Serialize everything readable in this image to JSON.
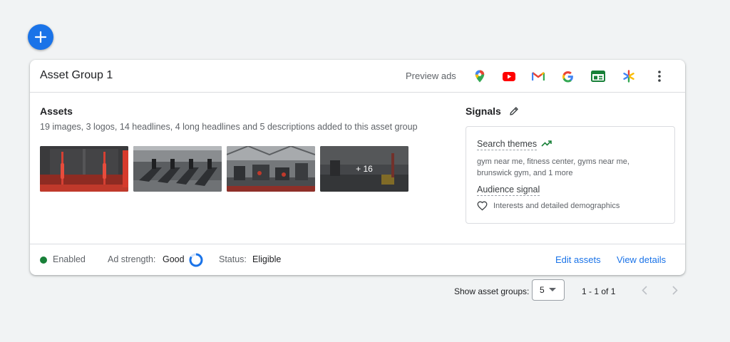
{
  "asset_group": {
    "title": "Asset Group 1",
    "preview_label": "Preview ads",
    "preview_icons": [
      "google-maps-icon",
      "youtube-icon",
      "gmail-icon",
      "google-search-icon",
      "display-network-icon",
      "discover-icon"
    ],
    "more_menu_icon": "more-vert-icon"
  },
  "assets": {
    "title": "Assets",
    "summary": "19 images, 3 logos, 14 headlines, 4 long headlines and 5 descriptions added to this asset group",
    "more_images_label": "+ 16"
  },
  "signals": {
    "title": "Signals",
    "search_themes_label": "Search themes",
    "search_themes_text": "gym near me, fitness center, gyms near me, brunswick gym, and 1 more",
    "audience_signal_label": "Audience signal",
    "audience_signal_text": "Interests and detailed demographics"
  },
  "footer": {
    "status_dot_color": "#188038",
    "enabled_label": "Enabled",
    "ad_strength_label": "Ad strength:",
    "ad_strength_value": "Good",
    "status_label": "Status:",
    "status_value": "Eligible",
    "edit_assets_label": "Edit assets",
    "view_details_label": "View details"
  },
  "pagination": {
    "show_label": "Show asset groups:",
    "page_size": "5",
    "range_text": "1 - 1 of 1"
  },
  "colors": {
    "accent": "#1a73e8",
    "trend": "#188038"
  }
}
